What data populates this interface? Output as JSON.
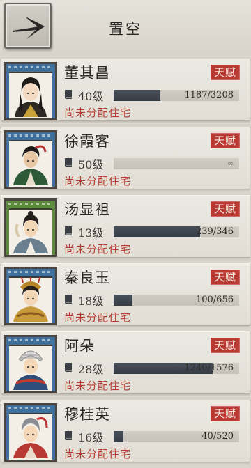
{
  "header": {
    "title": "置空",
    "back_icon": "arrow-right-icon"
  },
  "talent_label": "天赋",
  "residence_label": "尚未分配住宅",
  "colors": {
    "talent_bg": "#b83a33",
    "residence_text": "#b23a30",
    "bar_fill": "#3e444c"
  },
  "characters": [
    {
      "name": "董其昌",
      "level": "40级",
      "exp": "1187/3208",
      "progress": 0.37,
      "frame_color": "#3f6f9c"
    },
    {
      "name": "徐霞客",
      "level": "50级",
      "exp": "∞",
      "progress": 0,
      "frame_color": "#3f6f9c"
    },
    {
      "name": "汤显祖",
      "level": "13级",
      "exp": "239/346",
      "progress": 0.69,
      "frame_color": "#5a8a3a"
    },
    {
      "name": "秦良玉",
      "level": "18级",
      "exp": "100/656",
      "progress": 0.15,
      "frame_color": "#3f6f9c"
    },
    {
      "name": "阿朵",
      "level": "28级",
      "exp": "1240/1576",
      "progress": 0.79,
      "frame_color": "#3f6f9c"
    },
    {
      "name": "穆桂英",
      "level": "16级",
      "exp": "40/520",
      "progress": 0.08,
      "frame_color": "#3f6f9c"
    }
  ]
}
